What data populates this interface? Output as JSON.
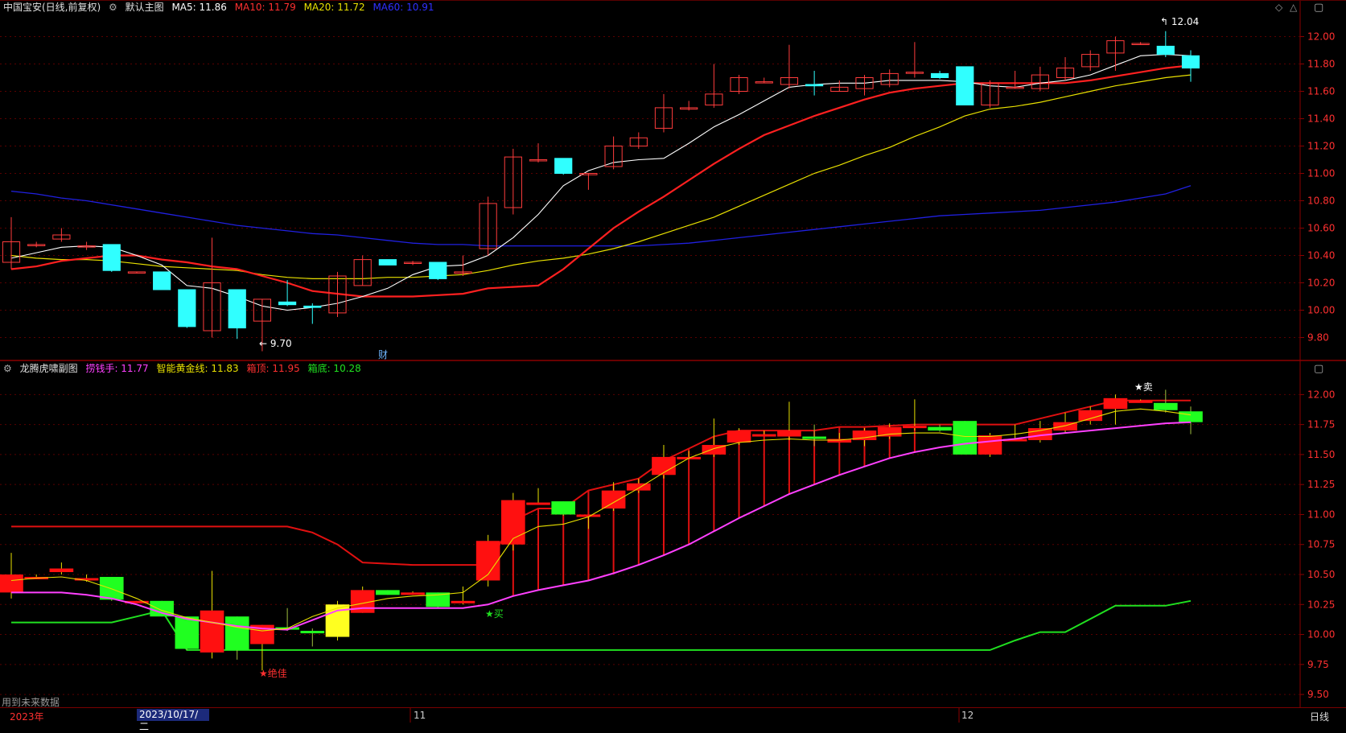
{
  "main_header": {
    "title": "中国宝安(日线,前复权)",
    "template": "默认主图",
    "ma5": "MA5: 11.86",
    "ma10": "MA10: 11.79",
    "ma20": "MA20: 11.72",
    "ma60": "MA60: 10.91"
  },
  "sub_header": {
    "title": "龙腾虎啸副图",
    "lq": "捞钱手: 11.77",
    "gold": "智能黄金线: 11.83",
    "top": "箱顶: 11.95",
    "bottom": "箱底: 10.28"
  },
  "annotations": {
    "high": "12.04",
    "low": "9.70",
    "fin": "财",
    "sell": "★卖",
    "buy": "★买",
    "best": "★绝佳",
    "future": "用到未来数据"
  },
  "timebar": {
    "y2023": "2023年",
    "cursor_date": "2023/10/17/二",
    "m11": "11",
    "m12": "12",
    "period": "日线"
  },
  "colors": {
    "up": "#ff3c3c",
    "down": "#30ffff",
    "ma5": "#ffffff",
    "ma10": "#ff2020",
    "ma20": "#e8e000",
    "ma60": "#2020e0",
    "lq": "#ff40ff",
    "box_top": "#e01010",
    "box_bottom": "#20e020"
  },
  "chart_data": [
    {
      "type": "candlestick",
      "title": "中国宝安(日线,前复权)",
      "y_ticks": [
        "12.00",
        "11.80",
        "11.60",
        "11.40",
        "11.20",
        "11.00",
        "10.80",
        "10.60",
        "10.40",
        "10.20",
        "10.00",
        "9.80"
      ],
      "ylim": [
        9.65,
        12.15
      ],
      "ohlc": [
        [
          10.35,
          10.5,
          10.68,
          10.3
        ],
        [
          10.48,
          10.48,
          10.5,
          10.46
        ],
        [
          10.52,
          10.55,
          10.6,
          10.5
        ],
        [
          10.47,
          10.47,
          10.5,
          10.44
        ],
        [
          10.48,
          10.29,
          10.48,
          10.28
        ],
        [
          10.28,
          10.28,
          10.28,
          10.27
        ],
        [
          10.28,
          10.15,
          10.28,
          10.15
        ],
        [
          10.15,
          9.88,
          10.15,
          9.87
        ],
        [
          9.85,
          10.2,
          10.53,
          9.8
        ],
        [
          10.15,
          9.87,
          10.15,
          9.79
        ],
        [
          9.92,
          10.08,
          10.08,
          9.7
        ],
        [
          10.06,
          10.04,
          10.22,
          10.03
        ],
        [
          10.03,
          10.02,
          10.05,
          9.9
        ],
        [
          9.98,
          10.25,
          10.28,
          9.95
        ],
        [
          10.18,
          10.37,
          10.4,
          10.18
        ],
        [
          10.37,
          10.33,
          10.37,
          10.33
        ],
        [
          10.35,
          10.35,
          10.36,
          10.33
        ],
        [
          10.35,
          10.23,
          10.35,
          10.22
        ],
        [
          10.27,
          10.28,
          10.4,
          10.25
        ],
        [
          10.45,
          10.78,
          10.83,
          10.4
        ],
        [
          10.75,
          11.12,
          11.18,
          10.7
        ],
        [
          11.1,
          11.1,
          11.22,
          11.08
        ],
        [
          11.11,
          11.0,
          11.11,
          10.99
        ],
        [
          10.99,
          11.0,
          11.0,
          10.88
        ],
        [
          11.05,
          11.2,
          11.27,
          11.03
        ],
        [
          11.2,
          11.26,
          11.3,
          11.18
        ],
        [
          11.33,
          11.48,
          11.58,
          11.3
        ],
        [
          11.47,
          11.48,
          11.53,
          11.46
        ],
        [
          11.5,
          11.58,
          11.8,
          11.48
        ],
        [
          11.6,
          11.7,
          11.72,
          11.58
        ],
        [
          11.67,
          11.67,
          11.7,
          11.66
        ],
        [
          11.65,
          11.7,
          11.94,
          11.62
        ],
        [
          11.65,
          11.64,
          11.75,
          11.57
        ],
        [
          11.6,
          11.63,
          11.68,
          11.6
        ],
        [
          11.62,
          11.7,
          11.72,
          11.57
        ],
        [
          11.65,
          11.73,
          11.76,
          11.63
        ],
        [
          11.74,
          11.74,
          11.96,
          11.7
        ],
        [
          11.73,
          11.7,
          11.75,
          11.69
        ],
        [
          11.78,
          11.5,
          11.78,
          11.5
        ],
        [
          11.5,
          11.66,
          11.68,
          11.48
        ],
        [
          11.63,
          11.63,
          11.75,
          11.62
        ],
        [
          11.62,
          11.72,
          11.78,
          11.6
        ],
        [
          11.7,
          11.77,
          11.85,
          11.68
        ],
        [
          11.78,
          11.87,
          11.9,
          11.75
        ],
        [
          11.88,
          11.97,
          12.0,
          11.75
        ],
        [
          11.95,
          11.95,
          11.96,
          11.94
        ],
        [
          11.93,
          11.87,
          12.04,
          11.85
        ],
        [
          11.86,
          11.77,
          11.9,
          11.67
        ]
      ],
      "ma5": [
        10.38,
        10.42,
        10.46,
        10.47,
        10.46,
        10.4,
        10.33,
        10.18,
        10.16,
        10.1,
        10.03,
        10.0,
        10.02,
        10.05,
        10.1,
        10.16,
        10.26,
        10.32,
        10.33,
        10.4,
        10.53,
        10.7,
        10.91,
        11.02,
        11.08,
        11.1,
        11.11,
        11.22,
        11.34,
        11.43,
        11.53,
        11.63,
        11.65,
        11.66,
        11.66,
        11.68,
        11.68,
        11.68,
        11.67,
        11.64,
        11.63,
        11.66,
        11.68,
        11.72,
        11.79,
        11.86,
        11.87,
        11.86
      ],
      "ma10": [
        10.3,
        10.32,
        10.36,
        10.38,
        10.4,
        10.4,
        10.37,
        10.35,
        10.32,
        10.3,
        10.25,
        10.2,
        10.14,
        10.12,
        10.1,
        10.1,
        10.1,
        10.11,
        10.12,
        10.16,
        10.17,
        10.18,
        10.3,
        10.45,
        10.6,
        10.72,
        10.83,
        10.95,
        11.07,
        11.18,
        11.28,
        11.35,
        11.42,
        11.48,
        11.54,
        11.59,
        11.62,
        11.64,
        11.66,
        11.66,
        11.66,
        11.66,
        11.66,
        11.68,
        11.71,
        11.74,
        11.77,
        11.79
      ],
      "ma20": [
        10.4,
        10.38,
        10.37,
        10.37,
        10.36,
        10.34,
        10.32,
        10.31,
        10.3,
        10.29,
        10.26,
        10.24,
        10.23,
        10.23,
        10.23,
        10.24,
        10.24,
        10.25,
        10.26,
        10.29,
        10.33,
        10.36,
        10.38,
        10.41,
        10.45,
        10.5,
        10.56,
        10.62,
        10.68,
        10.76,
        10.84,
        10.92,
        11.0,
        11.06,
        11.13,
        11.19,
        11.27,
        11.34,
        11.42,
        11.47,
        11.49,
        11.52,
        11.56,
        11.6,
        11.64,
        11.67,
        11.7,
        11.72
      ],
      "ma60": [
        10.87,
        10.85,
        10.82,
        10.8,
        10.77,
        10.74,
        10.71,
        10.68,
        10.65,
        10.62,
        10.6,
        10.58,
        10.56,
        10.55,
        10.53,
        10.51,
        10.49,
        10.48,
        10.48,
        10.47,
        10.47,
        10.47,
        10.47,
        10.47,
        10.47,
        10.47,
        10.48,
        10.49,
        10.51,
        10.53,
        10.55,
        10.57,
        10.59,
        10.61,
        10.63,
        10.65,
        10.67,
        10.69,
        10.7,
        10.71,
        10.72,
        10.73,
        10.75,
        10.77,
        10.79,
        10.82,
        10.85,
        10.91
      ]
    },
    {
      "type": "indicator",
      "title": "龙腾虎啸副图",
      "y_ticks": [
        "12.00",
        "11.75",
        "11.50",
        "11.25",
        "11.00",
        "10.75",
        "10.50",
        "10.25",
        "10.00",
        "9.75",
        "9.50"
      ],
      "ylim": [
        9.4,
        12.15
      ],
      "box_top": [
        10.9,
        10.9,
        10.9,
        10.9,
        10.9,
        10.9,
        10.9,
        10.9,
        10.9,
        10.9,
        10.9,
        10.9,
        10.85,
        10.75,
        10.6,
        10.59,
        10.58,
        10.58,
        10.58,
        10.58,
        10.95,
        11.05,
        11.05,
        11.2,
        11.25,
        11.3,
        11.45,
        11.55,
        11.65,
        11.7,
        11.7,
        11.7,
        11.7,
        11.73,
        11.73,
        11.74,
        11.75,
        11.75,
        11.75,
        11.75,
        11.75,
        11.8,
        11.85,
        11.9,
        11.95,
        11.95,
        11.95,
        11.95
      ],
      "box_bottom": [
        10.1,
        10.1,
        10.1,
        10.1,
        10.1,
        10.15,
        10.2,
        9.87,
        9.87,
        9.87,
        9.87,
        9.87,
        9.87,
        9.87,
        9.87,
        9.87,
        9.87,
        9.87,
        9.87,
        9.87,
        9.87,
        9.87,
        9.87,
        9.87,
        9.87,
        9.87,
        9.87,
        9.87,
        9.87,
        9.87,
        9.87,
        9.87,
        9.87,
        9.87,
        9.87,
        9.87,
        9.87,
        9.87,
        9.87,
        9.87,
        9.95,
        10.02,
        10.02,
        10.13,
        10.24,
        10.24,
        10.24,
        10.28
      ],
      "lq_line": [
        10.35,
        10.35,
        10.35,
        10.33,
        10.3,
        10.25,
        10.18,
        10.13,
        10.1,
        10.07,
        10.05,
        10.04,
        10.12,
        10.2,
        10.22,
        10.22,
        10.22,
        10.22,
        10.22,
        10.25,
        10.32,
        10.37,
        10.41,
        10.45,
        10.51,
        10.58,
        10.66,
        10.75,
        10.86,
        10.97,
        11.07,
        11.17,
        11.25,
        11.33,
        11.4,
        11.47,
        11.52,
        11.56,
        11.59,
        11.61,
        11.63,
        11.66,
        11.68,
        11.7,
        11.72,
        11.74,
        11.76,
        11.77
      ],
      "gold_line": [
        10.45,
        10.47,
        10.48,
        10.45,
        10.38,
        10.3,
        10.2,
        10.14,
        10.1,
        10.06,
        10.03,
        10.05,
        10.15,
        10.22,
        10.26,
        10.3,
        10.32,
        10.33,
        10.35,
        10.5,
        10.8,
        10.9,
        10.92,
        10.98,
        11.1,
        11.22,
        11.35,
        11.47,
        11.55,
        11.6,
        11.62,
        11.63,
        11.62,
        11.62,
        11.64,
        11.67,
        11.68,
        11.68,
        11.65,
        11.65,
        11.67,
        11.7,
        11.74,
        11.8,
        11.86,
        11.88,
        11.86,
        11.83
      ]
    }
  ]
}
